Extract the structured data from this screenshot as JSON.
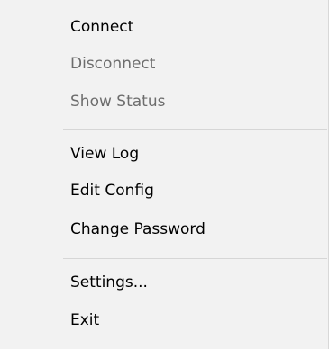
{
  "menu": {
    "items": [
      {
        "label": "Connect",
        "enabled": true
      },
      {
        "label": "Disconnect",
        "enabled": false
      },
      {
        "label": "Show Status",
        "enabled": false
      },
      {
        "label": "View Log",
        "enabled": true
      },
      {
        "label": "Edit Config",
        "enabled": true
      },
      {
        "label": "Change Password",
        "enabled": true
      },
      {
        "label": "Settings...",
        "enabled": true
      },
      {
        "label": "Exit",
        "enabled": true
      }
    ]
  },
  "colors": {
    "background": "#f2f2f2",
    "text_enabled": "#000000",
    "text_disabled": "#6d6d6d",
    "separator": "#d6d6d6"
  }
}
